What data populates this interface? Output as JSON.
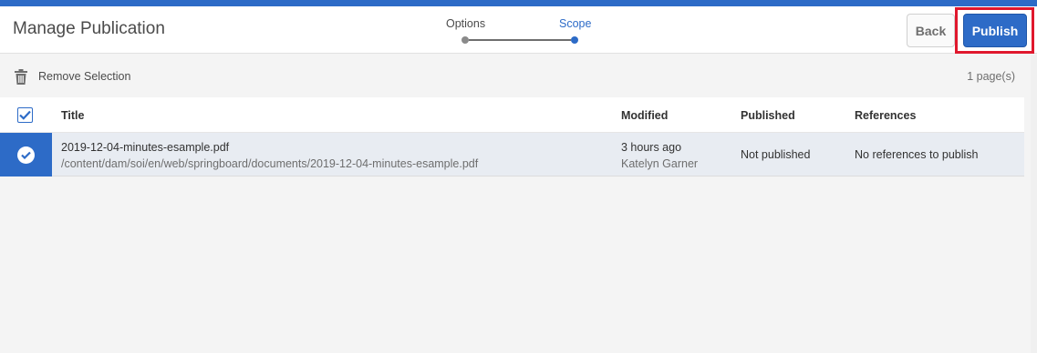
{
  "window": {
    "title": "Manage Publication"
  },
  "wizard": {
    "steps": [
      {
        "label": "Options",
        "state": "done"
      },
      {
        "label": "Scope",
        "state": "current"
      }
    ]
  },
  "header_actions": {
    "back_label": "Back",
    "publish_label": "Publish"
  },
  "action_bar": {
    "remove_label": "Remove Selection",
    "page_count": "1 page(s)"
  },
  "table": {
    "columns": [
      "Title",
      "Modified",
      "Published",
      "References"
    ],
    "rows": [
      {
        "selected": true,
        "title": "2019-12-04-minutes-esample.pdf",
        "path": "/content/dam/soi/en/web/springboard/documents/2019-12-04-minutes-esample.pdf",
        "modified": "3 hours ago",
        "modified_by": "Katelyn Garner",
        "published": "Not published",
        "references": "No references to publish"
      }
    ]
  },
  "colors": {
    "accent": "#2d6bc7",
    "highlight": "#e0182d",
    "background": "#f4f4f4"
  },
  "icons": {
    "trash": "trash-icon",
    "checkbox": "checkbox-icon",
    "row_check": "check-circle-icon"
  }
}
